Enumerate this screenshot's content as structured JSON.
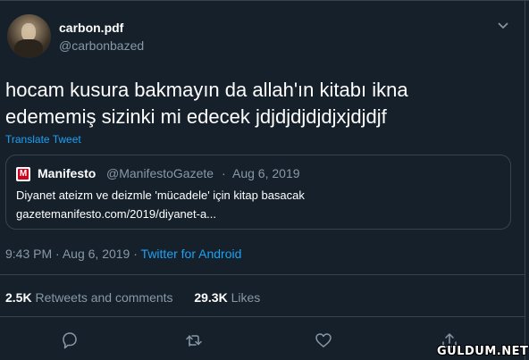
{
  "author": {
    "display_name": "carbon.pdf",
    "handle": "@carbonbazed"
  },
  "tweet": {
    "text_line1": "hocam kusura bakmayın da allah'ın kitabı ikna",
    "text_line2": "edememiş sizinki mi edecek jdjdjdjdjdjxjdjdjf",
    "translate_label": "Translate Tweet"
  },
  "quote": {
    "logo_letter": "M",
    "name": "Manifesto",
    "handle": "@ManifestoGazete",
    "separator": "·",
    "date": "Aug 6, 2019",
    "line1": "Diyanet ateizm ve deizmle 'mücadele' için kitap basacak",
    "line2": "gazetemanifesto.com/2019/diyanet-a..."
  },
  "meta": {
    "time": "9:43 PM",
    "separator": "·",
    "date": "Aug 6, 2019",
    "source": "Twitter for Android"
  },
  "stats": {
    "retweets_count": "2.5K",
    "retweets_label": "Retweets and comments",
    "likes_count": "29.3K",
    "likes_label": "Likes"
  },
  "actions": [
    "reply-icon",
    "retweet-icon",
    "like-icon",
    "share-icon"
  ],
  "watermark": "GULDUM.NET",
  "colors": {
    "background": "#15202b",
    "border": "#38444d",
    "secondary_text": "#8899a6",
    "accent": "#1da1f2"
  }
}
